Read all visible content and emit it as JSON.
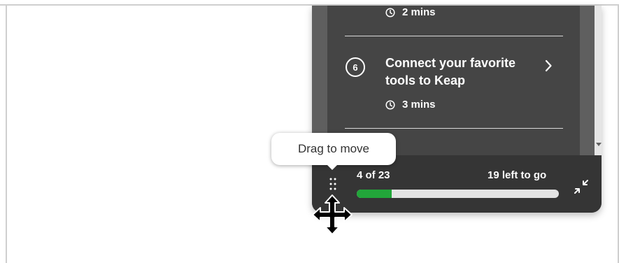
{
  "checklist": {
    "prev_item": {
      "duration": "2 mins"
    },
    "items": [
      {
        "step": "6",
        "title": "Connect your favorite tools to Keap",
        "duration": "3 mins"
      }
    ]
  },
  "progress": {
    "count_label": "4 of 23",
    "remaining_label": "19 left to go",
    "completed": 4,
    "total": 23
  },
  "tooltip": {
    "text": "Drag to move"
  },
  "icons": {
    "clock": "clock-icon",
    "chevron": "chevron-right-icon",
    "collapse": "collapse-icon",
    "drag": "drag-handle-icon",
    "cursor": "move-cursor-icon"
  },
  "colors": {
    "panel_bg": "#454545",
    "footer_bg": "#353535",
    "progress_fill": "#22a63a",
    "progress_track": "#e3e3e3"
  }
}
